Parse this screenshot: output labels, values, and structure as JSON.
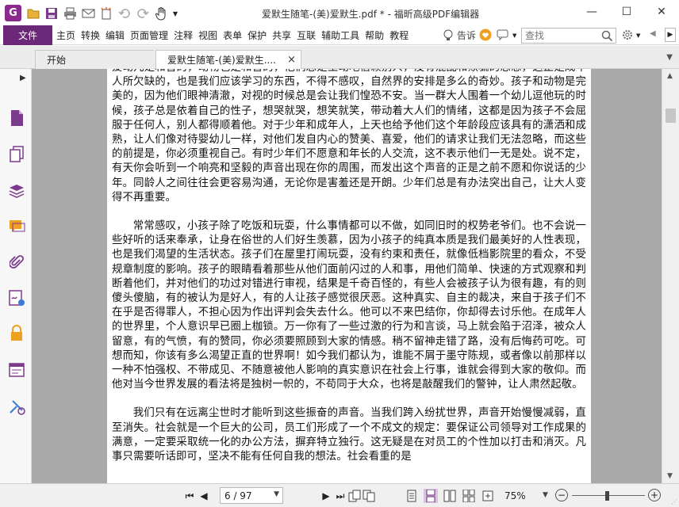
{
  "window": {
    "title": "爱默生随笔-(美)爱默生.pdf * - 福昕高级PDF编辑器",
    "app_logo": "G",
    "controls": [
      "minimize-icon",
      "maximize-icon",
      "close-icon"
    ]
  },
  "quick_access": [
    "open-icon",
    "save-icon",
    "print-icon",
    "email-icon",
    "new-icon",
    "undo-icon",
    "redo-icon",
    "hand-tool-icon",
    "dropdown-icon"
  ],
  "menubar": {
    "file_label": "文件",
    "items": [
      "主页",
      "转换",
      "编辑",
      "页面管理",
      "注释",
      "视图",
      "表单",
      "保护",
      "共享",
      "互联",
      "辅助工具",
      "帮助",
      "教程"
    ],
    "tell_label": "告诉",
    "search_placeholder": "查找"
  },
  "tabs": {
    "start_label": "开始",
    "doc_label": "爱默生随笔-(美)爱默生....",
    "close_glyph": "×"
  },
  "sidebar": {
    "icons": [
      "expand-arrow-icon",
      "page-thumbnail-icon",
      "copy-pages-icon",
      "layers-icon",
      "comments-icon",
      "attachment-icon",
      "signature-icon",
      "lock-icon",
      "form-fields-icon",
      "certify-icon"
    ]
  },
  "document": {
    "paragraphs": [
      "爱动儿是和善的，动物也是和善的，他们总是生动地信赖别人，没有混乱和欺骗的思想，这正是成年人所欠缺的，也是我们应该学习的东西，不得不感叹，自然界的安排是多么的奇妙。孩子和动物是完美的，因为他们眼神清澈，对视的时候总是会让我们惶恐不安。当一群大人围着一个幼儿逗他玩的时候，孩子总是依着自己的性子，想哭就哭，想笑就笑，带动着大人们的情绪，这都是因为孩子不会屈服于任何人，别人都得顺着他。对于少年和成年人，上天也给予他们这个年龄段应该具有的潇洒和成熟，让人们像对待婴幼儿一样，对他们发自内心的赞美、喜爱，他们的请求让我们无法忽略，而这些的前提是，你必须重视自己。有时少年们不愿意和年长的人交流，这不表示他们一无是处。说不定，有天你会听到一个响亮和坚毅的声音出现在你的周围，而发出这个声音的正是之前不愿和你说话的少年。同龄人之间往往会更容易沟通，无论你是害羞还是开朗。少年们总是有办法突出自己，让大人变得不再重要。",
      "常常感叹，小孩子除了吃饭和玩耍，什么事情都可以不做，如同旧时的权势老爷们。也不会说一些好听的话来奉承，让身在俗世的人们好生羡慕，因为小孩子的纯真本质是我们最美好的人性表现，也是我们渴望的生活状态。孩子们在屋里打闹玩耍，没有约束和责任，就像低档影院里的看众，不受规章制度的影响。孩子的眼睛看着那些从他们面前闪过的人和事，用他们简单、快速的方式观察和判断着他们，并对他们的功过对错进行审视，结果是千奇百怪的，有些人会被孩子认为很有趣，有的则傻头傻脑，有的被认为是好人，有的人让孩子感觉很厌恶。这种真实、自主的裁决，来自于孩子们不在乎是否得罪人，不担心因为作出评判会失去什么。他可以不来巴结你，你却得去讨乐他。在成年人的世界里，个人意识早已圈上枷锁。万一你有了一些过激的行为和言谈，马上就会陷于沼泽，被众人留意，有的气愤，有的赞同，你必须要照顾到大家的情感。稍不留神走错了路，没有后悔药可吃。可想而知，你该有多么渴望正直的世界啊！如今我们都认为，谁能不屑于墨守陈规，或者像以前那样以一种不怕强权、不带成见、不随意被他人影响的真实意识在社会上行事，谁就会得到大家的敬仰。而他对当今世界发展的看法将是独树一帜的，不苟同于大众，也将是敲醒我们的警钟，让人肃然起敬。",
      "我们只有在远离尘世时才能听到这些振奋的声音。当我们跨入纷扰世界，声音开始慢慢减弱，直至消失。社会就是一个巨大的公司，员工们形成了一个不成文的规定：要保证公司领导对工作成果的满意，一定要采取统一化的办公方法，摒弃特立独行。这无疑是在对员工的个性加以打击和消灭。凡事只需要听话即可，坚决不能有任何自我的想法。社会看重的是"
    ]
  },
  "statusbar": {
    "page_display": "6 / 97",
    "zoom": "75%",
    "nav_icons": [
      "first-page-icon",
      "prev-page-icon",
      "next-page-icon",
      "last-page-icon",
      "prev-view-icon",
      "next-view-icon"
    ],
    "view_icons": [
      "single-page-icon",
      "continuous-icon",
      "facing-icon",
      "continuous-facing-icon",
      "fit-icon"
    ]
  },
  "colors": {
    "accent": "#6b2778",
    "doc_bg": "#a9a9a9"
  }
}
